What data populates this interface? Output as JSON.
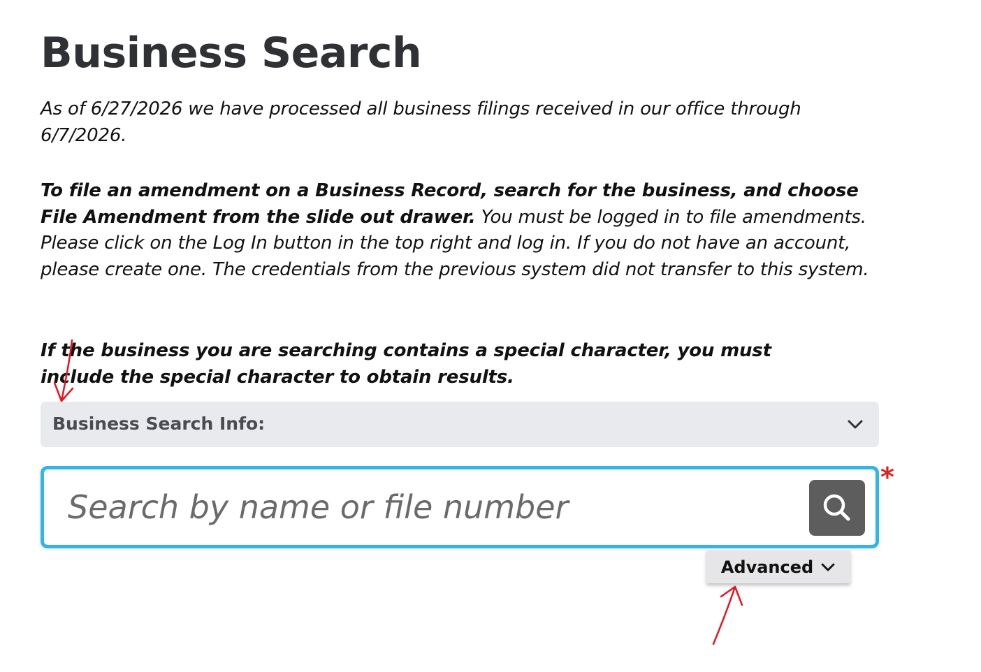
{
  "page": {
    "title": "Business Search"
  },
  "notice": {
    "processed_text": "As of 6/27/2026 we have processed all business filings received in our office through 6/7/2026.",
    "amendment_bold": "To file an amendment on a Business Record, search for the business, and choose File Amendment from the slide out drawer.",
    "amendment_text": " You must be logged in to file amendments. Please click on the Log In button in the top right and log in. If you do not have an account, please create one. The credentials from the previous system did not transfer to this system.",
    "special_char_bold": "If the business you are searching contains a special character, you must include the special character to obtain results."
  },
  "info_panel": {
    "label": "Business Search Info:",
    "icon": "chevron-down-icon"
  },
  "search": {
    "placeholder": "Search by name or file number",
    "value": "",
    "required_marker": "*",
    "button_icon": "search-icon"
  },
  "advanced": {
    "label": "Advanced",
    "icon": "chevron-down-icon"
  },
  "colors": {
    "title": "#2f3135",
    "input_border": "#2fb6e6",
    "search_button_bg": "#5d5d5d",
    "info_bar_bg": "#e9eaed",
    "required": "#e0201c",
    "annotation_arrows": "#e8141c"
  }
}
